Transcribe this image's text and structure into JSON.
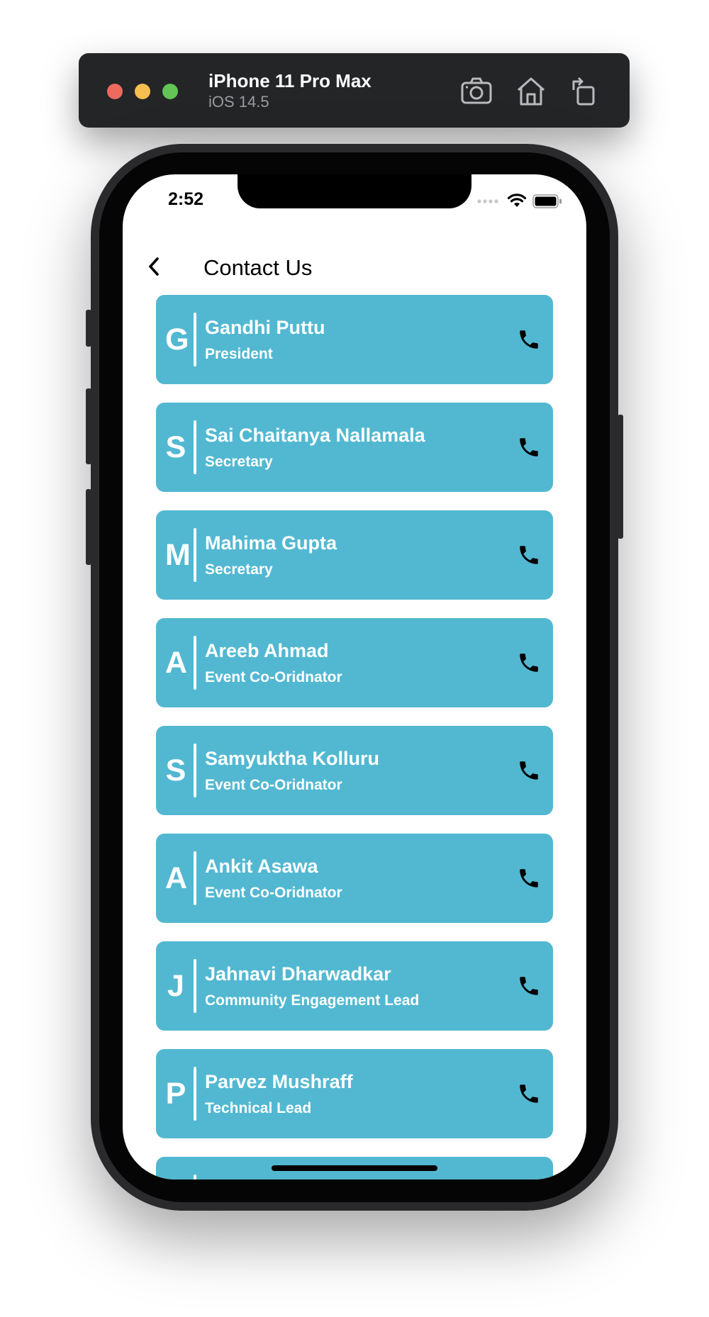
{
  "simulator": {
    "device_name": "iPhone 11 Pro Max",
    "os_version": "iOS 14.5",
    "icons": [
      "screenshot-icon",
      "home-icon",
      "rotate-icon"
    ]
  },
  "status_bar": {
    "time": "2:52",
    "icons": [
      "signal-icon",
      "wifi-icon",
      "battery-icon"
    ]
  },
  "header": {
    "back_icon": "chevron-left-icon",
    "title": "Contact Us"
  },
  "colors": {
    "card": "#52b8d1",
    "card_text": "#ffffff",
    "phone_icon": "#000000"
  },
  "contacts": [
    {
      "initial": "G",
      "name": "Gandhi Puttu",
      "role": "President"
    },
    {
      "initial": "S",
      "name": "Sai Chaitanya Nallamala",
      "role": "Secretary"
    },
    {
      "initial": "M",
      "name": "Mahima Gupta",
      "role": "Secretary"
    },
    {
      "initial": "A",
      "name": "Areeb Ahmad",
      "role": "Event Co-Oridnator"
    },
    {
      "initial": "S",
      "name": "Samyuktha Kolluru",
      "role": "Event Co-Oridnator"
    },
    {
      "initial": "A",
      "name": "Ankit Asawa",
      "role": "Event Co-Oridnator"
    },
    {
      "initial": "J",
      "name": "Jahnavi Dharwadkar",
      "role": "Community Engagement Lead"
    },
    {
      "initial": "P",
      "name": "Parvez Mushraff",
      "role": "Technical Lead"
    },
    {
      "initial": "",
      "name": "",
      "role": ""
    }
  ]
}
